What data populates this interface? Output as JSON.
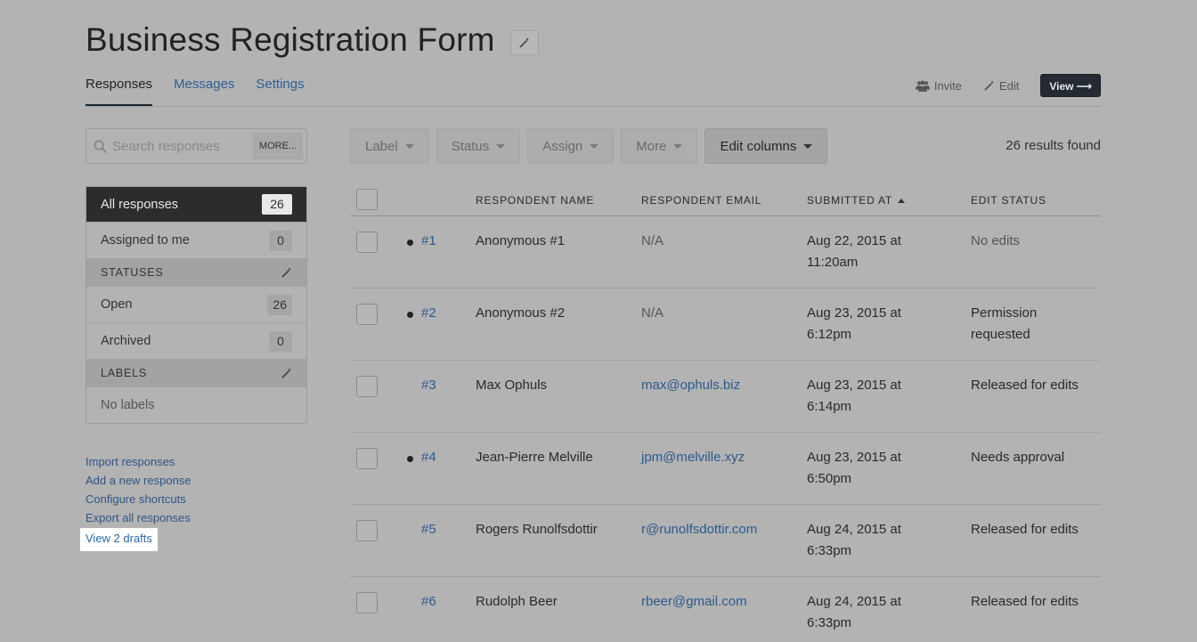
{
  "header": {
    "title": "Business Registration Form",
    "tabs": [
      {
        "label": "Responses",
        "active": true
      },
      {
        "label": "Messages",
        "active": false
      },
      {
        "label": "Settings",
        "active": false
      }
    ],
    "actions": {
      "invite": "Invite",
      "edit": "Edit",
      "view": "View ⟶"
    }
  },
  "sidebar": {
    "search": {
      "placeholder": "Search responses",
      "value": "",
      "more_label": "MORE..."
    },
    "items": [
      {
        "label": "All responses",
        "count": "26"
      },
      {
        "label": "Assigned to me",
        "count": "0"
      }
    ],
    "statuses_header": "STATUSES",
    "statuses": [
      {
        "label": "Open",
        "count": "26"
      },
      {
        "label": "Archived",
        "count": "0"
      }
    ],
    "labels_header": "LABELS",
    "labels_empty": "No labels",
    "links": [
      "Import responses",
      "Add a new response",
      "Configure shortcuts",
      "Export all responses",
      "View 2 drafts"
    ]
  },
  "toolbar": {
    "label": "Label",
    "status": "Status",
    "assign": "Assign",
    "more": "More",
    "edit_columns": "Edit columns",
    "results": "26 results found"
  },
  "table": {
    "columns": [
      "RESPONDENT NAME",
      "RESPONDENT EMAIL",
      "SUBMITTED AT",
      "EDIT STATUS"
    ],
    "sort": {
      "column": "SUBMITTED AT",
      "direction": "ascending"
    },
    "rows": [
      {
        "num": "#1",
        "unread": true,
        "name": "Anonymous #1",
        "email": "N/A",
        "date": "Aug 22, 2015 at",
        "time": "11:20am",
        "status": "No edits"
      },
      {
        "num": "#2",
        "unread": true,
        "name": "Anonymous #2",
        "email": "N/A",
        "date": "Aug 23, 2015 at",
        "time": "6:12pm",
        "status": "Permission requested"
      },
      {
        "num": "#3",
        "unread": false,
        "name": "Max Ophuls",
        "email": "max@ophuls.biz",
        "date": "Aug 23, 2015 at",
        "time": "6:14pm",
        "status": "Released for edits"
      },
      {
        "num": "#4",
        "unread": true,
        "name": "Jean-Pierre Melville",
        "email": "jpm@melville.xyz",
        "date": "Aug 23, 2015 at",
        "time": "6:50pm",
        "status": "Needs approval"
      },
      {
        "num": "#5",
        "unread": false,
        "name": "Rogers Runolfsdottir",
        "email": "r@runolfsdottir.com",
        "date": "Aug 24, 2015 at",
        "time": "6:33pm",
        "status": "Released for edits"
      },
      {
        "num": "#6",
        "unread": false,
        "name": "Rudolph Beer",
        "email": "rbeer@gmail.com",
        "date": "Aug 24, 2015 at",
        "time": "6:33pm",
        "status": "Released for edits"
      }
    ]
  }
}
